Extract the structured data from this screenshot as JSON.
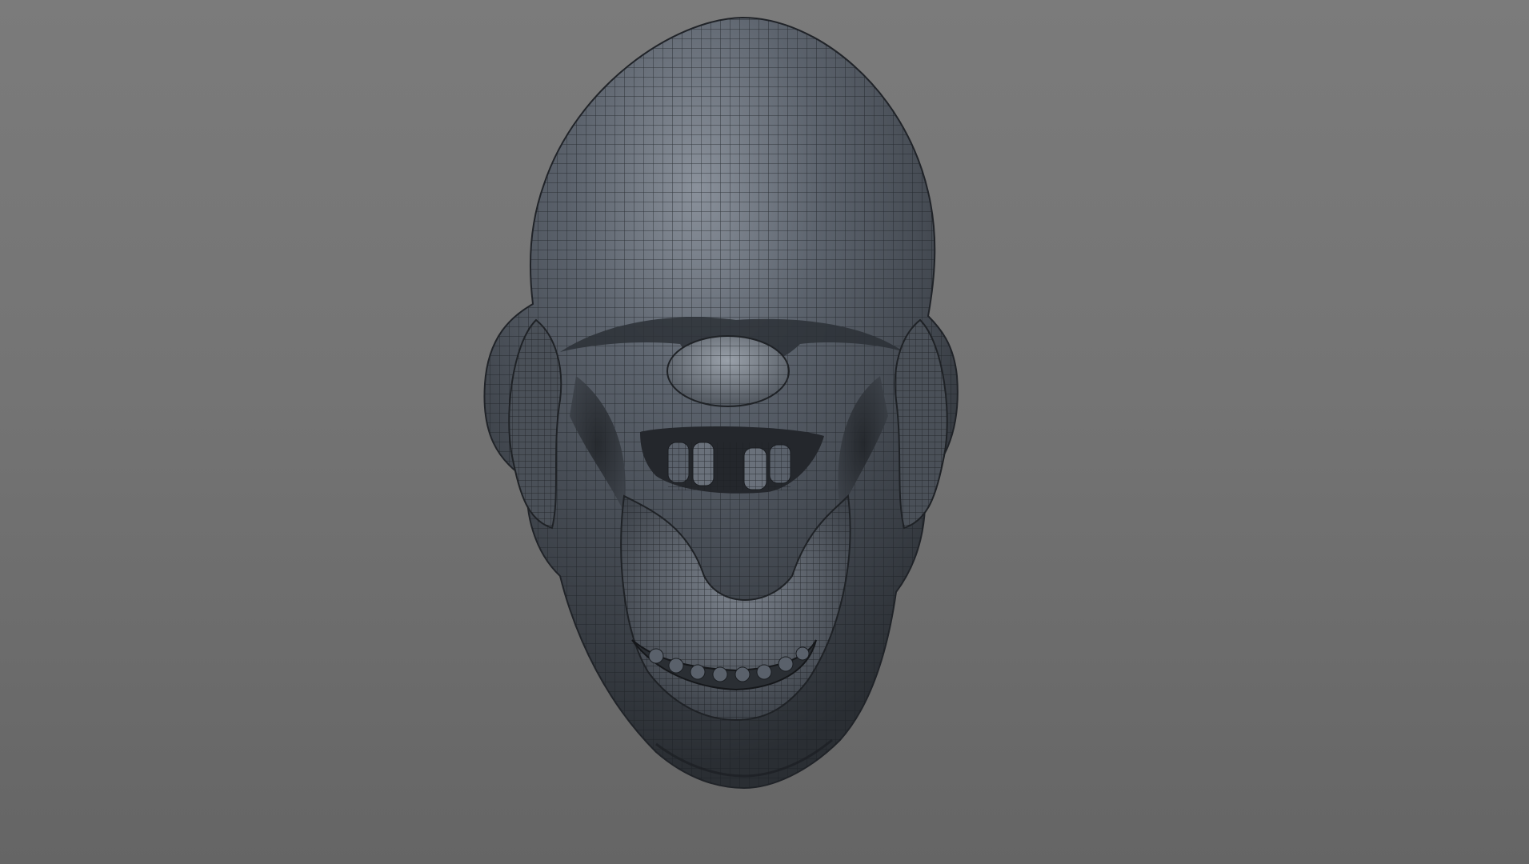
{
  "viewport": {
    "background_top": "#7b7b7b",
    "background_bottom": "#656565"
  },
  "model": {
    "name_icon": "wireframe-skull-mesh",
    "surface_color": "#3f454d",
    "highlight_color": "#8a919b",
    "wire_color": "#1b1e22",
    "shading": "smooth-shaded-with-wireframe"
  }
}
